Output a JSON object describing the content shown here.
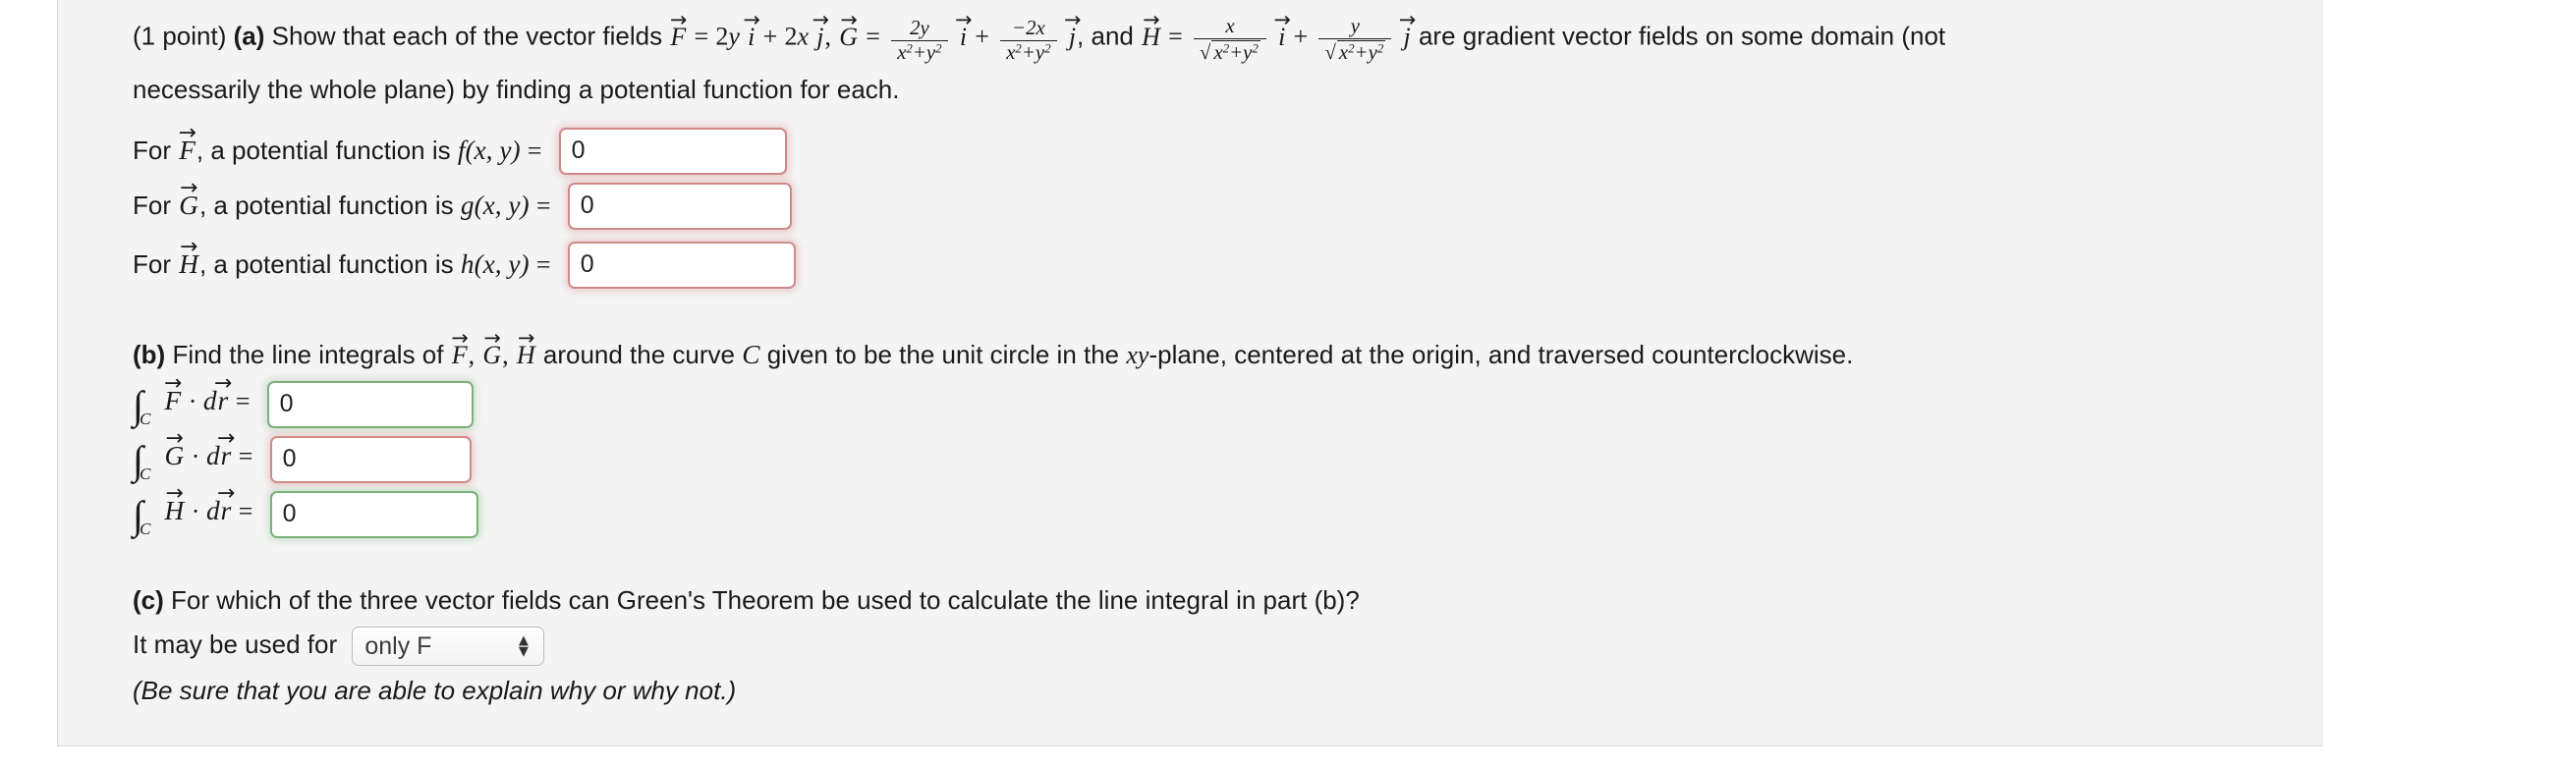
{
  "problem": {
    "points_label": "(1 point)",
    "part_a_label": "(a)",
    "part_b_label": "(b)",
    "part_c_label": "(c)",
    "intro_text_1": "Show that each of the vector fields",
    "field_F_name": "F",
    "field_G_name": "G",
    "field_H_name": "H",
    "eq": "=",
    "plus": "+",
    "comma": ",",
    "and_word": ", and",
    "F_term1_coef": "2",
    "F_term1_var": "y",
    "F_term2_coef": "2",
    "F_term2_var": "x",
    "G_frac1_num": "2y",
    "G_frac1_den": "x²+y²",
    "G_frac2_num": "−2x",
    "G_frac2_den": "x²+y²",
    "H_frac1_num": "x",
    "H_frac1_den": "√x²+y²",
    "H_frac2_num": "y",
    "H_frac2_den": "√x²+y²",
    "i_hat": "i",
    "j_hat": "j",
    "tail_text_1": "are gradient vector fields on some domain (not",
    "line2_text": "necessarily the whole plane) by finding a potential function for each."
  },
  "part_a": {
    "rows": [
      {
        "prefix": "For",
        "field": "F",
        "middle": ", a potential function is",
        "fn_name": "f",
        "fn_args": "(x, y)",
        "equals": "=",
        "value": "0",
        "border_state": "red"
      },
      {
        "prefix": "For",
        "field": "G",
        "middle": ", a potential function is",
        "fn_name": "g",
        "fn_args": "(x, y)",
        "equals": "=",
        "value": "0",
        "border_state": "red"
      },
      {
        "prefix": "For",
        "field": "H",
        "middle": ", a potential function is",
        "fn_name": "h",
        "fn_args": "(x, y)",
        "equals": "=",
        "value": "0",
        "border_state": "red"
      }
    ]
  },
  "part_b": {
    "text_before": "Find the line integrals of",
    "fields_list": "F, G, H",
    "text_middle": "around the curve",
    "curve_name": "C",
    "text_after": "given to be the unit circle in the",
    "plane_name": "xy",
    "text_end": "-plane, centered at the origin, and traversed counterclockwise.",
    "rows": [
      {
        "integral_sub": "C",
        "field": "F",
        "dot": "·",
        "differential": "dr",
        "equals": "=",
        "value": "0",
        "border_state": "green"
      },
      {
        "integral_sub": "C",
        "field": "G",
        "dot": "·",
        "differential": "dr",
        "equals": "=",
        "value": "0",
        "border_state": "red"
      },
      {
        "integral_sub": "C",
        "field": "H",
        "dot": "·",
        "differential": "dr",
        "equals": "=",
        "value": "0",
        "border_state": "green"
      }
    ]
  },
  "part_c": {
    "question": "For which of the three vector fields can Green's Theorem be used to calculate the line integral in part (b)?",
    "prompt": "It may be used for",
    "selected_option": "only F",
    "note": "(Be sure that you are able to explain why or why not.)",
    "up_arrow": "▲",
    "down_arrow": "▼"
  },
  "colors": {
    "panel_background": "#f4f4f4",
    "page_background": "#ffffff",
    "text": "#1a1a1a",
    "border_red": "#d08a8a",
    "border_green": "#7bb07b",
    "select_border": "#b9b9b9"
  }
}
